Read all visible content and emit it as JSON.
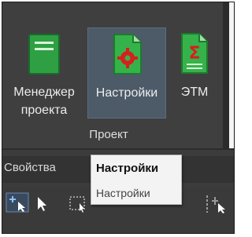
{
  "ribbon": {
    "buttons": [
      {
        "label_line1": "Менеджер",
        "label_line2": "проекта",
        "icon": "project-manager-icon"
      },
      {
        "label": "Настройки",
        "icon": "settings-document-icon"
      },
      {
        "label": "ЭТМ",
        "icon": "etm-sigma-document-icon"
      }
    ],
    "group_label": "Проект",
    "colors": {
      "panel": "#3f3f3f",
      "selected": "#4d5a68",
      "icon_green": "#2ea043"
    }
  },
  "properties": {
    "label": "Свойства"
  },
  "tooltip": {
    "title": "Настройки",
    "description": "Настройки"
  },
  "toolbar": {
    "icons": [
      "add-point-cursor-icon",
      "select-cursor-icon",
      "selection-box-icon",
      "vertical-cursor-icon"
    ]
  }
}
